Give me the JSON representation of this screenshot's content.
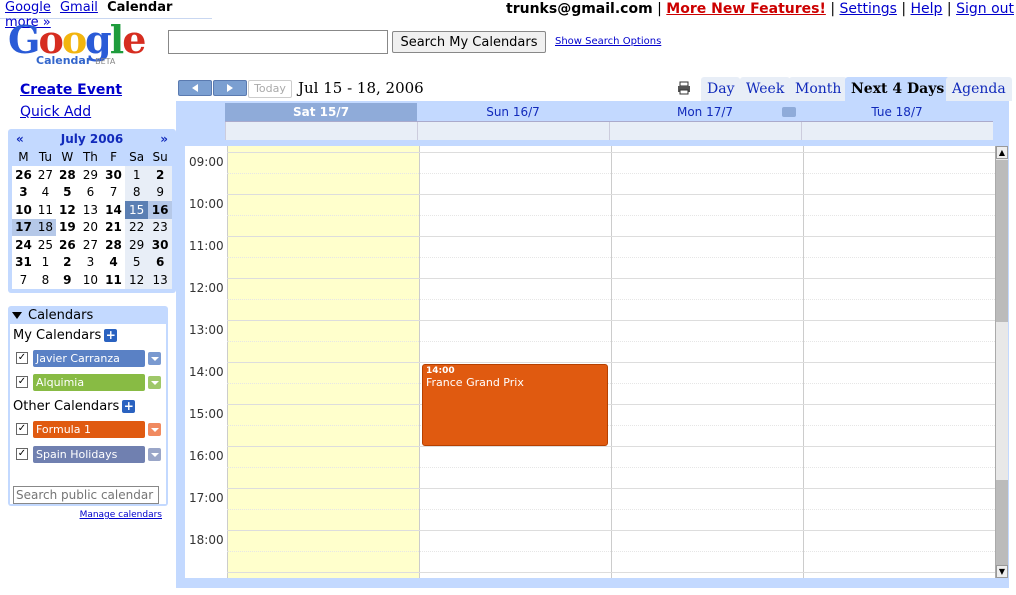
{
  "gbar": {
    "google": "Google",
    "gmail": "Gmail",
    "calendar": "Calendar",
    "more": "more »"
  },
  "user": {
    "email": "trunks@gmail.com",
    "new_features": "More New Features!",
    "settings": "Settings",
    "help": "Help",
    "signout": "Sign out",
    "sep": "|"
  },
  "logo": {
    "word": "Google",
    "product": "Calendar",
    "beta": "BETA"
  },
  "search": {
    "button": "Search My Calendars",
    "options": "Show Search Options",
    "value": ""
  },
  "left": {
    "create": "Create Event",
    "quickadd": "Quick Add"
  },
  "minical": {
    "prev": "«",
    "next": "»",
    "month": "July 2006",
    "weekdays": [
      "M",
      "Tu",
      "W",
      "Th",
      "F",
      "Sa",
      "Su"
    ],
    "weeks": [
      [
        "26",
        "27",
        "28",
        "29",
        "30",
        "1",
        "2"
      ],
      [
        "3",
        "4",
        "5",
        "6",
        "7",
        "8",
        "9"
      ],
      [
        "10",
        "11",
        "12",
        "13",
        "14",
        "15",
        "16"
      ],
      [
        "17",
        "18",
        "19",
        "20",
        "21",
        "22",
        "23"
      ],
      [
        "24",
        "25",
        "26",
        "27",
        "28",
        "29",
        "30"
      ],
      [
        "31",
        "1",
        "2",
        "3",
        "4",
        "5",
        "6"
      ],
      [
        "7",
        "8",
        "9",
        "10",
        "11",
        "12",
        "13"
      ]
    ]
  },
  "calendars": {
    "title": "Calendars",
    "my": "My Calendars",
    "other": "Other Calendars",
    "items": [
      {
        "name": "Javier Carranza",
        "color": "#5a81c5",
        "checked": "✓"
      },
      {
        "name": "Alquimia",
        "color": "#88bb44",
        "checked": "✓"
      },
      {
        "name": "Formula 1",
        "color": "#e05a10",
        "checked": "✓"
      },
      {
        "name": "Spain Holidays",
        "color": "#7080b0",
        "checked": "✓"
      }
    ],
    "public_placeholder": "Search public calendar",
    "manage": "Manage calendars"
  },
  "toolbar": {
    "today": "Today",
    "range": "Jul 15 - 18, 2006"
  },
  "tabs": [
    "Day",
    "Week",
    "Month",
    "Next 4 Days",
    "Agenda"
  ],
  "days": [
    "Sat 15/7",
    "Sun 16/7",
    "Mon 17/7",
    "Tue 18/7"
  ],
  "hours": [
    "09:00",
    "10:00",
    "11:00",
    "12:00",
    "13:00",
    "14:00",
    "15:00",
    "16:00",
    "17:00",
    "18:00"
  ],
  "event": {
    "time": "14:00",
    "title": "France Grand Prix",
    "color": "#e05a10"
  }
}
